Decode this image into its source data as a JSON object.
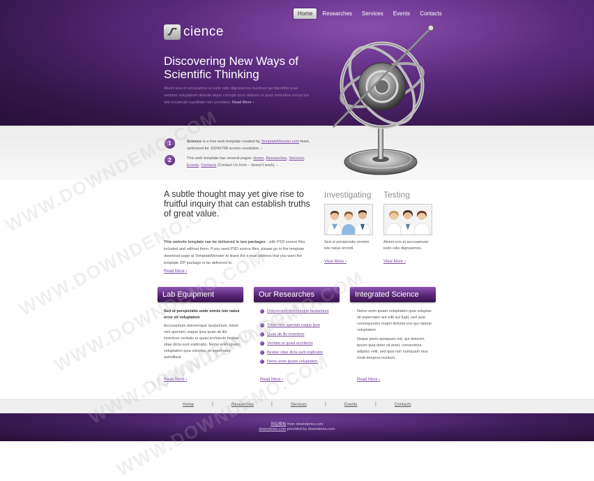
{
  "nav": [
    "Home",
    "Researches",
    "Services",
    "Events",
    "Contacts"
  ],
  "logo": {
    "mark": "S",
    "text": "cience"
  },
  "hero": {
    "title": "Discovering New Ways of Scientific Thinking",
    "text": "Alvero eos et accusamus et iusto odio dignissimos ducimus qui blanditiis prae sentium voluptatum deleniti atque corrupti quos dolores et quas molestias excep turi sint occaecati cupiditate non provident.",
    "more": "Read More"
  },
  "intro": {
    "step1": {
      "num": "1",
      "brand": "Science",
      "text1": " is a free web template created by ",
      "link": "TemplateMonster.com",
      "text2": " team, optimized for 1024X768 screen resolution."
    },
    "step2": {
      "num": "2",
      "text1": "This web template has several pages: ",
      "link1": "Home",
      "link2": "Researches",
      "link3": "Services",
      "link4": "Events",
      "link5": "Contacts",
      "text2": " (Contact Us form – doesn’t work)."
    }
  },
  "subtle": {
    "title": "A subtle thought may yet give rise to fruitful inquiry that can establish truths of great value.",
    "bold": "This website template can be delivered in two packages",
    "text": " - with PSD source files included and without them. If you need PSD source files, please go to the template download page at TemplateMonster to leave the e-mail address that you want the template ZIP package to be delivered to.",
    "more": "Read More"
  },
  "investigating": {
    "title": "Investigating",
    "text": "Sed ut perspiciatis unemni iste natus errordl.",
    "more": "View More"
  },
  "testing": {
    "title": "Testing",
    "text": "Alvero eos et accusamuse iusto odio dignissimos.",
    "more": "View More"
  },
  "lab": {
    "title": "Lab Equipment",
    "bold": "Sed ut perspiciatis unde omnis iste natus error sit voluptatem",
    "text": "Accusantium doloremque laudantium, totam rem aperiam, eaque ipsa quae ab illo inventore veritatis et quasi architecto beatae vitae dicta sunt explicabo. Nemo enim ipsam voluptatem quia voluptas sit aspernatur autoditaut.",
    "more": "Read More"
  },
  "researches": {
    "title": "Our Researches",
    "items": [
      "Doloremium doloremque laudantium",
      "Totam rem aperiam eaque ipsa",
      "Quae ab illo inventore",
      "Veritatis et quasi architecto",
      "Beatae vitae dicta sunt explicabo",
      "Nemo enim ipsam voluptatem"
    ],
    "more": "Read More"
  },
  "integrated": {
    "title": "Integrated Science",
    "text1": "Nemo enim ipsam voluptatem quia voluptas sit aspernatur aut odit aut fugit, sed quia consequuntur magni dolores eos qui ratione voluptatem.",
    "text2": "Neque porro quisquam est, qui dolorem ipsum quia dolor sit amet, consectetur, adipisci velit, sed quia non numquam eius modi tempora incidunt.",
    "more": "Read More"
  },
  "footer_nav": [
    "Home",
    "Researches",
    "Services",
    "Events",
    "Contacts"
  ],
  "footer": {
    "line1_link": "网站模板",
    "line1_text": " from downdemo.com",
    "line2_link": "downdemo.com",
    "line2_text": " provided by downdemo.com"
  },
  "watermark": "WWW.DOWNDEMO.COM"
}
